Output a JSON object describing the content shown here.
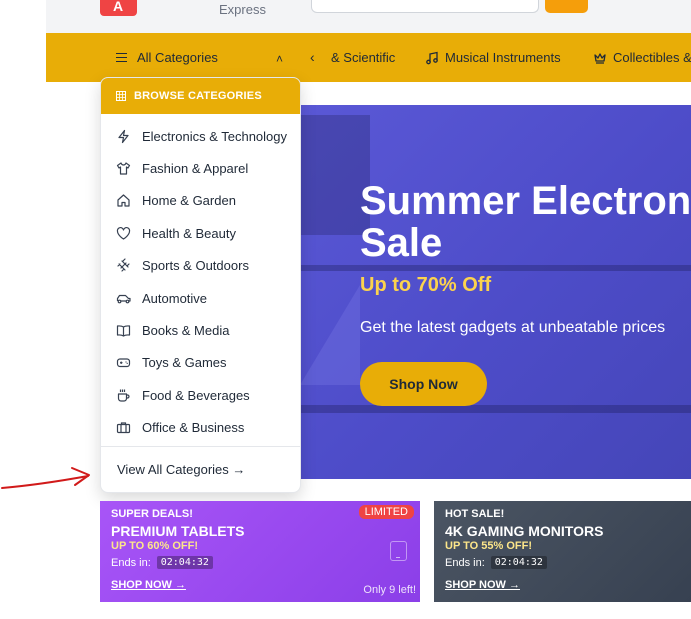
{
  "header": {
    "logo_letter": "A",
    "brand_sub": "Express"
  },
  "nav": {
    "all_categories": "All Categories",
    "items": [
      {
        "label": "& Scientific",
        "icon": "none"
      },
      {
        "label": "Musical Instruments",
        "icon": "music-icon"
      },
      {
        "label": "Collectibles &",
        "icon": "crown-icon"
      }
    ]
  },
  "dropdown": {
    "header": "BROWSE CATEGORIES",
    "items": [
      {
        "label": "Electronics & Technology",
        "icon": "lightning-icon"
      },
      {
        "label": "Fashion & Apparel",
        "icon": "shirt-icon"
      },
      {
        "label": "Home & Garden",
        "icon": "home-icon"
      },
      {
        "label": "Health & Beauty",
        "icon": "heart-icon"
      },
      {
        "label": "Sports & Outdoors",
        "icon": "dumbbell-icon"
      },
      {
        "label": "Automotive",
        "icon": "car-icon"
      },
      {
        "label": "Books & Media",
        "icon": "book-icon"
      },
      {
        "label": "Toys & Games",
        "icon": "gamepad-icon"
      },
      {
        "label": "Food & Beverages",
        "icon": "cup-icon"
      },
      {
        "label": "Office & Business",
        "icon": "briefcase-icon"
      }
    ],
    "footer": "View All Categories →"
  },
  "hero": {
    "title_line1": "Summer Electronics",
    "title_line2": "Sale",
    "subtitle": "Up to 70% Off",
    "description": "Get the latest gadgets at unbeatable prices",
    "button": "Shop Now"
  },
  "promos": [
    {
      "kicker": "SUPER DEALS!",
      "title": "PREMIUM TABLETS",
      "off": "UP TO 60% OFF!",
      "ends_label": "Ends in:",
      "timer": "02:04:32",
      "shop": "SHOP NOW →",
      "badge": "LIMITED",
      "stock": "Only 9 left!",
      "color": "#a855f7"
    },
    {
      "kicker": "HOT SALE!",
      "title": "4K GAMING MONITORS",
      "off": "UP TO 55% OFF!",
      "ends_label": "Ends in:",
      "timer": "02:04:32",
      "shop": "SHOP NOW →",
      "color": "#4b5563"
    }
  ],
  "colors": {
    "accent": "#e8ad07",
    "hero_bg": "#5a58d6",
    "badge_red": "#ef4444",
    "annotation_arrow": "#d11a1a"
  }
}
